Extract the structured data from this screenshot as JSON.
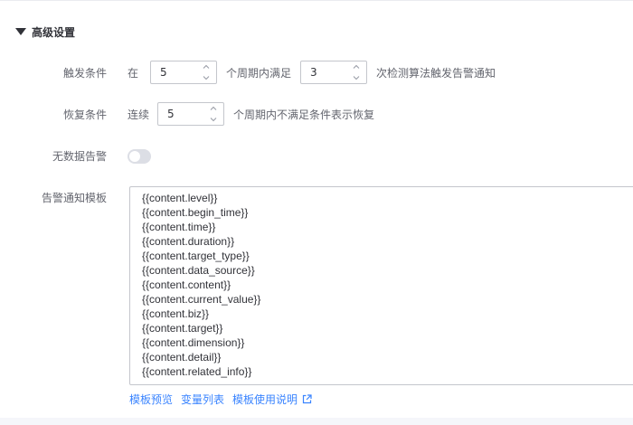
{
  "section": {
    "title": "高级设置"
  },
  "trigger": {
    "label": "触发条件",
    "prefix": "在",
    "period_value": "5",
    "middle": "个周期内满足",
    "count_value": "3",
    "suffix": "次检测算法触发告警通知"
  },
  "recovery": {
    "label": "恢复条件",
    "prefix": "连续",
    "period_value": "5",
    "suffix": "个周期内不满足条件表示恢复"
  },
  "no_data": {
    "label": "无数据告警",
    "enabled": false
  },
  "template": {
    "label": "告警通知模板",
    "lines": [
      "{{content.level}}",
      "{{content.begin_time}}",
      "{{content.time}}",
      "{{content.duration}}",
      "{{content.target_type}}",
      "{{content.data_source}}",
      "{{content.content}}",
      "{{content.current_value}}",
      "{{content.biz}}",
      "{{content.target}}",
      "{{content.dimension}}",
      "{{content.detail}}",
      "{{content.related_info}}"
    ]
  },
  "links": {
    "preview": "模板预览",
    "variables": "变量列表",
    "help": "模板使用说明"
  },
  "colors": {
    "accent": "#3a84ff",
    "toggle_off": "#dcdee5"
  }
}
